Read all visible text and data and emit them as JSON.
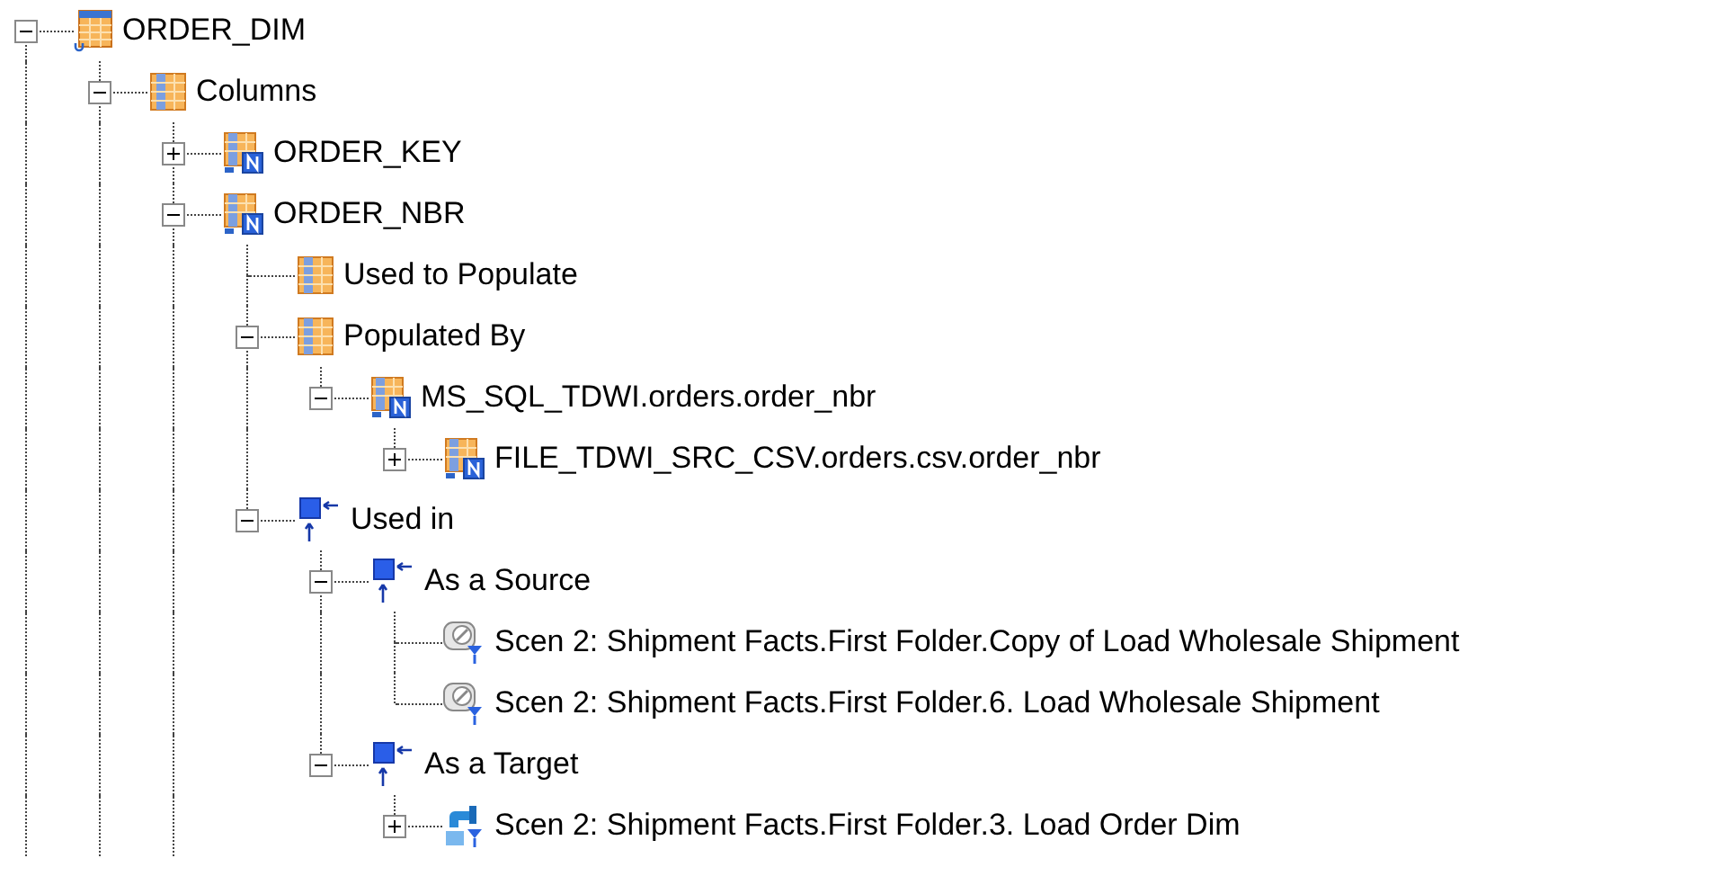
{
  "tree": [
    {
      "label": "ORDER_DIM",
      "kind": "table",
      "expanded": true,
      "has_more": true,
      "children": [
        {
          "label": "Columns",
          "kind": "folder",
          "expanded": true,
          "has_more": true,
          "children": [
            {
              "label": "ORDER_KEY",
              "kind": "column",
              "expanded": false
            },
            {
              "label": "ORDER_NBR",
              "kind": "column",
              "expanded": true,
              "has_more": true,
              "children": [
                {
                  "label": "Used to Populate",
                  "kind": "folder"
                },
                {
                  "label": "Populated By",
                  "kind": "folder",
                  "expanded": true,
                  "children": [
                    {
                      "label": "MS_SQL_TDWI.orders.order_nbr",
                      "kind": "column",
                      "expanded": true,
                      "children": [
                        {
                          "label": "FILE_TDWI_SRC_CSV.orders.csv.order_nbr",
                          "kind": "column",
                          "expanded": false
                        }
                      ]
                    }
                  ]
                },
                {
                  "label": "Used in",
                  "kind": "usage",
                  "expanded": true,
                  "children": [
                    {
                      "label": "As a Source",
                      "kind": "usage",
                      "expanded": true,
                      "children": [
                        {
                          "label": "Scen 2: Shipment Facts.First Folder.Copy of Load Wholesale Shipment",
                          "kind": "mapping"
                        },
                        {
                          "label": "Scen 2: Shipment Facts.First Folder.6. Load Wholesale Shipment",
                          "kind": "mapping"
                        }
                      ]
                    },
                    {
                      "label": "As a Target",
                      "kind": "usage",
                      "expanded": true,
                      "children": [
                        {
                          "label": "Scen 2: Shipment Facts.First Folder.3. Load Order Dim",
                          "kind": "process",
                          "expanded": false
                        }
                      ]
                    }
                  ]
                }
              ]
            }
          ]
        }
      ]
    }
  ]
}
